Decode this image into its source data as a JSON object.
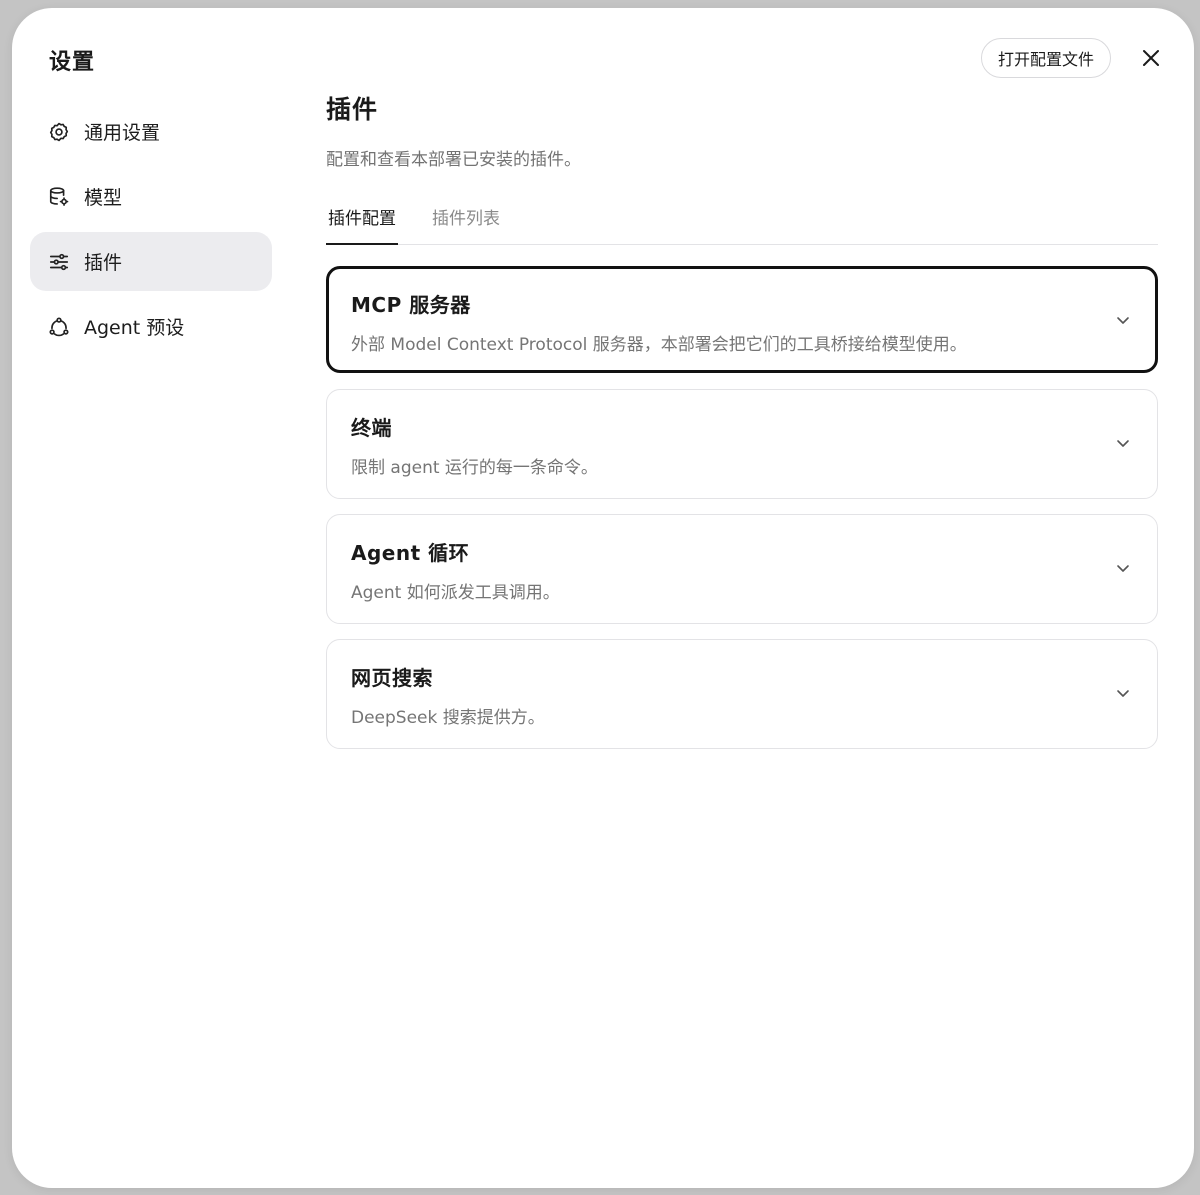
{
  "sidebar": {
    "title": "设置",
    "items": [
      {
        "label": "通用设置",
        "icon": "gear-icon",
        "active": false
      },
      {
        "label": "模型",
        "icon": "database-gear-icon",
        "active": false
      },
      {
        "label": "插件",
        "icon": "sliders-icon",
        "active": true
      },
      {
        "label": "Agent 预设",
        "icon": "agent-cycle-icon",
        "active": false
      }
    ]
  },
  "header": {
    "open_config_label": "打开配置文件",
    "close_icon": "close-icon"
  },
  "main": {
    "title": "插件",
    "description": "配置和查看本部署已安装的插件。",
    "tabs": [
      {
        "label": "插件配置",
        "active": true
      },
      {
        "label": "插件列表",
        "active": false
      }
    ],
    "cards": [
      {
        "title": "MCP 服务器",
        "description": "外部 Model Context Protocol 服务器，本部署会把它们的工具桥接给模型使用。",
        "focused": true
      },
      {
        "title": "终端",
        "description": "限制 agent 运行的每一条命令。",
        "focused": false
      },
      {
        "title": "Agent 循环",
        "description": "Agent 如何派发工具调用。",
        "focused": false
      },
      {
        "title": "网页搜索",
        "description": "DeepSeek 搜索提供方。",
        "focused": false
      }
    ]
  },
  "colors": {
    "active_nav_bg": "#ececef",
    "border": "#e3e3e6",
    "focus_border": "#111111",
    "muted_text": "#757575"
  }
}
